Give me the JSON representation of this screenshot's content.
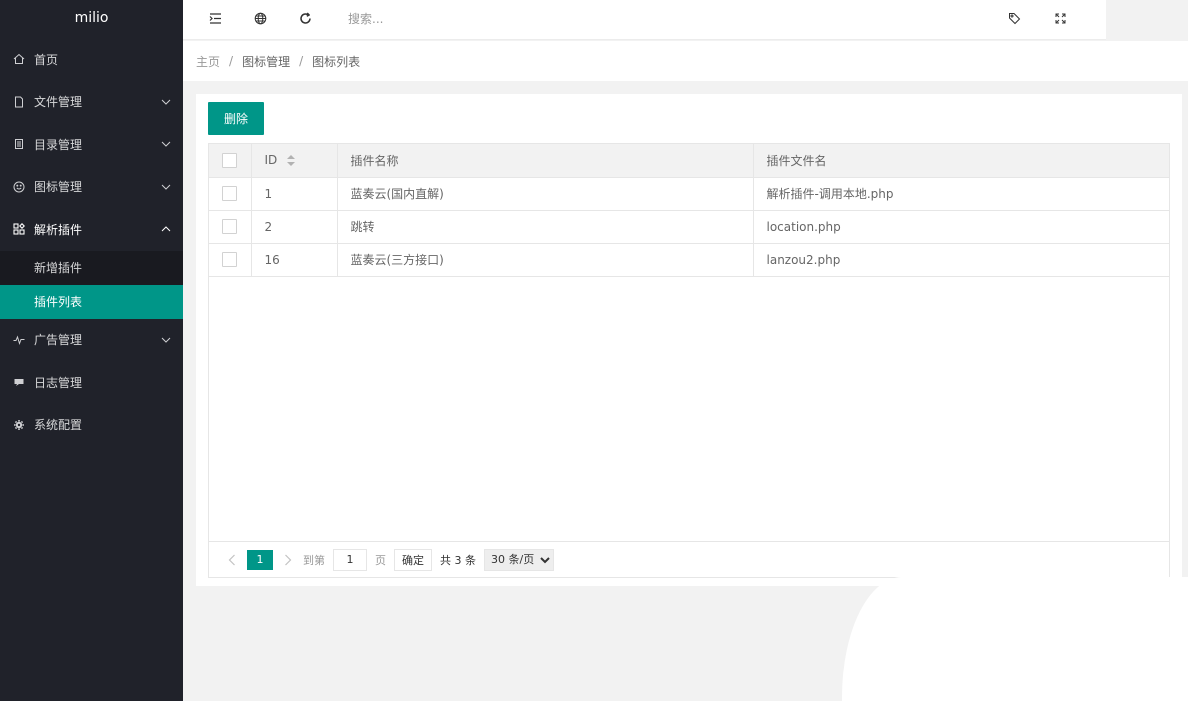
{
  "app": {
    "logo": "milio"
  },
  "sidebar": {
    "items": [
      {
        "label": "首页",
        "icon": "home-icon"
      },
      {
        "label": "文件管理",
        "icon": "file-icon"
      },
      {
        "label": "目录管理",
        "icon": "list-icon"
      },
      {
        "label": "图标管理",
        "icon": "smile-icon"
      },
      {
        "label": "解析插件",
        "icon": "apps-icon"
      },
      {
        "label": "广告管理",
        "icon": "pulse-icon"
      },
      {
        "label": "日志管理",
        "icon": "chat-icon"
      },
      {
        "label": "系统配置",
        "icon": "gear-icon"
      }
    ],
    "subitems": [
      {
        "label": "新增插件"
      },
      {
        "label": "插件列表"
      }
    ]
  },
  "header": {
    "search_placeholder": "搜索..."
  },
  "breadcrumb": [
    "主页",
    "图标管理",
    "图标列表"
  ],
  "toolbar": {
    "delete_label": "删除"
  },
  "table": {
    "columns": [
      "ID",
      "插件名称",
      "插件文件名"
    ],
    "rows": [
      {
        "id": "1",
        "name": "蓝奏云(国内直解)",
        "file": "解析插件-调用本地.php"
      },
      {
        "id": "2",
        "name": "跳转",
        "file": "location.php"
      },
      {
        "id": "16",
        "name": "蓝奏云(三方接口)",
        "file": "lanzou2.php"
      }
    ]
  },
  "pager": {
    "current": "1",
    "goto_label": "到第",
    "goto_value": "1",
    "page_label": "页",
    "confirm_label": "确定",
    "total_label": "共 3 条",
    "limit_option": "30 条/页"
  },
  "colors": {
    "accent": "#009688",
    "sidebar": "#20222a"
  }
}
